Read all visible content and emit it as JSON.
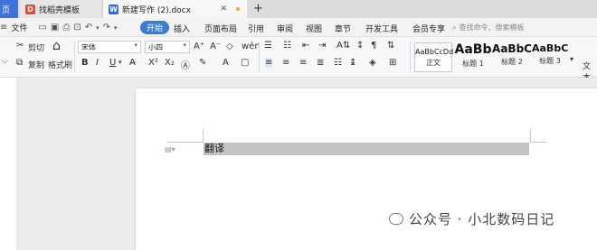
{
  "tabs": [
    {
      "label": "页",
      "active": false
    },
    {
      "label": "找稻壳模板",
      "active": false
    },
    {
      "label": "新建写作 (2).docx",
      "active": true
    }
  ],
  "tab_add": "+",
  "menu": {
    "file": "文件",
    "items": [
      "开始",
      "插入",
      "页面布局",
      "引用",
      "审阅",
      "视图",
      "章节",
      "开发工具",
      "会员专享"
    ],
    "search_placeholder": "查找命令、搜索模板"
  },
  "ribbon": {
    "cut": "剪切",
    "copy": "复制",
    "format_painter": "格式刷",
    "font_name": "宋体",
    "font_size": "小四",
    "bold": "B",
    "italic": "I",
    "underline": "U",
    "styles": [
      {
        "preview": "AaBbCcDd",
        "label": "正文"
      },
      {
        "preview": "AaBb",
        "label": "标题 1"
      },
      {
        "preview": "AaBbC",
        "label": "标题 2"
      },
      {
        "preview": "AaBbC",
        "label": "标题 3"
      }
    ],
    "more": "文本"
  },
  "document": {
    "text": "翻译"
  },
  "watermark": {
    "account": "公众号 · 小北数码日记"
  },
  "colors": {
    "accent": "#3a7bd5",
    "highlight": "#c3c3c3"
  }
}
